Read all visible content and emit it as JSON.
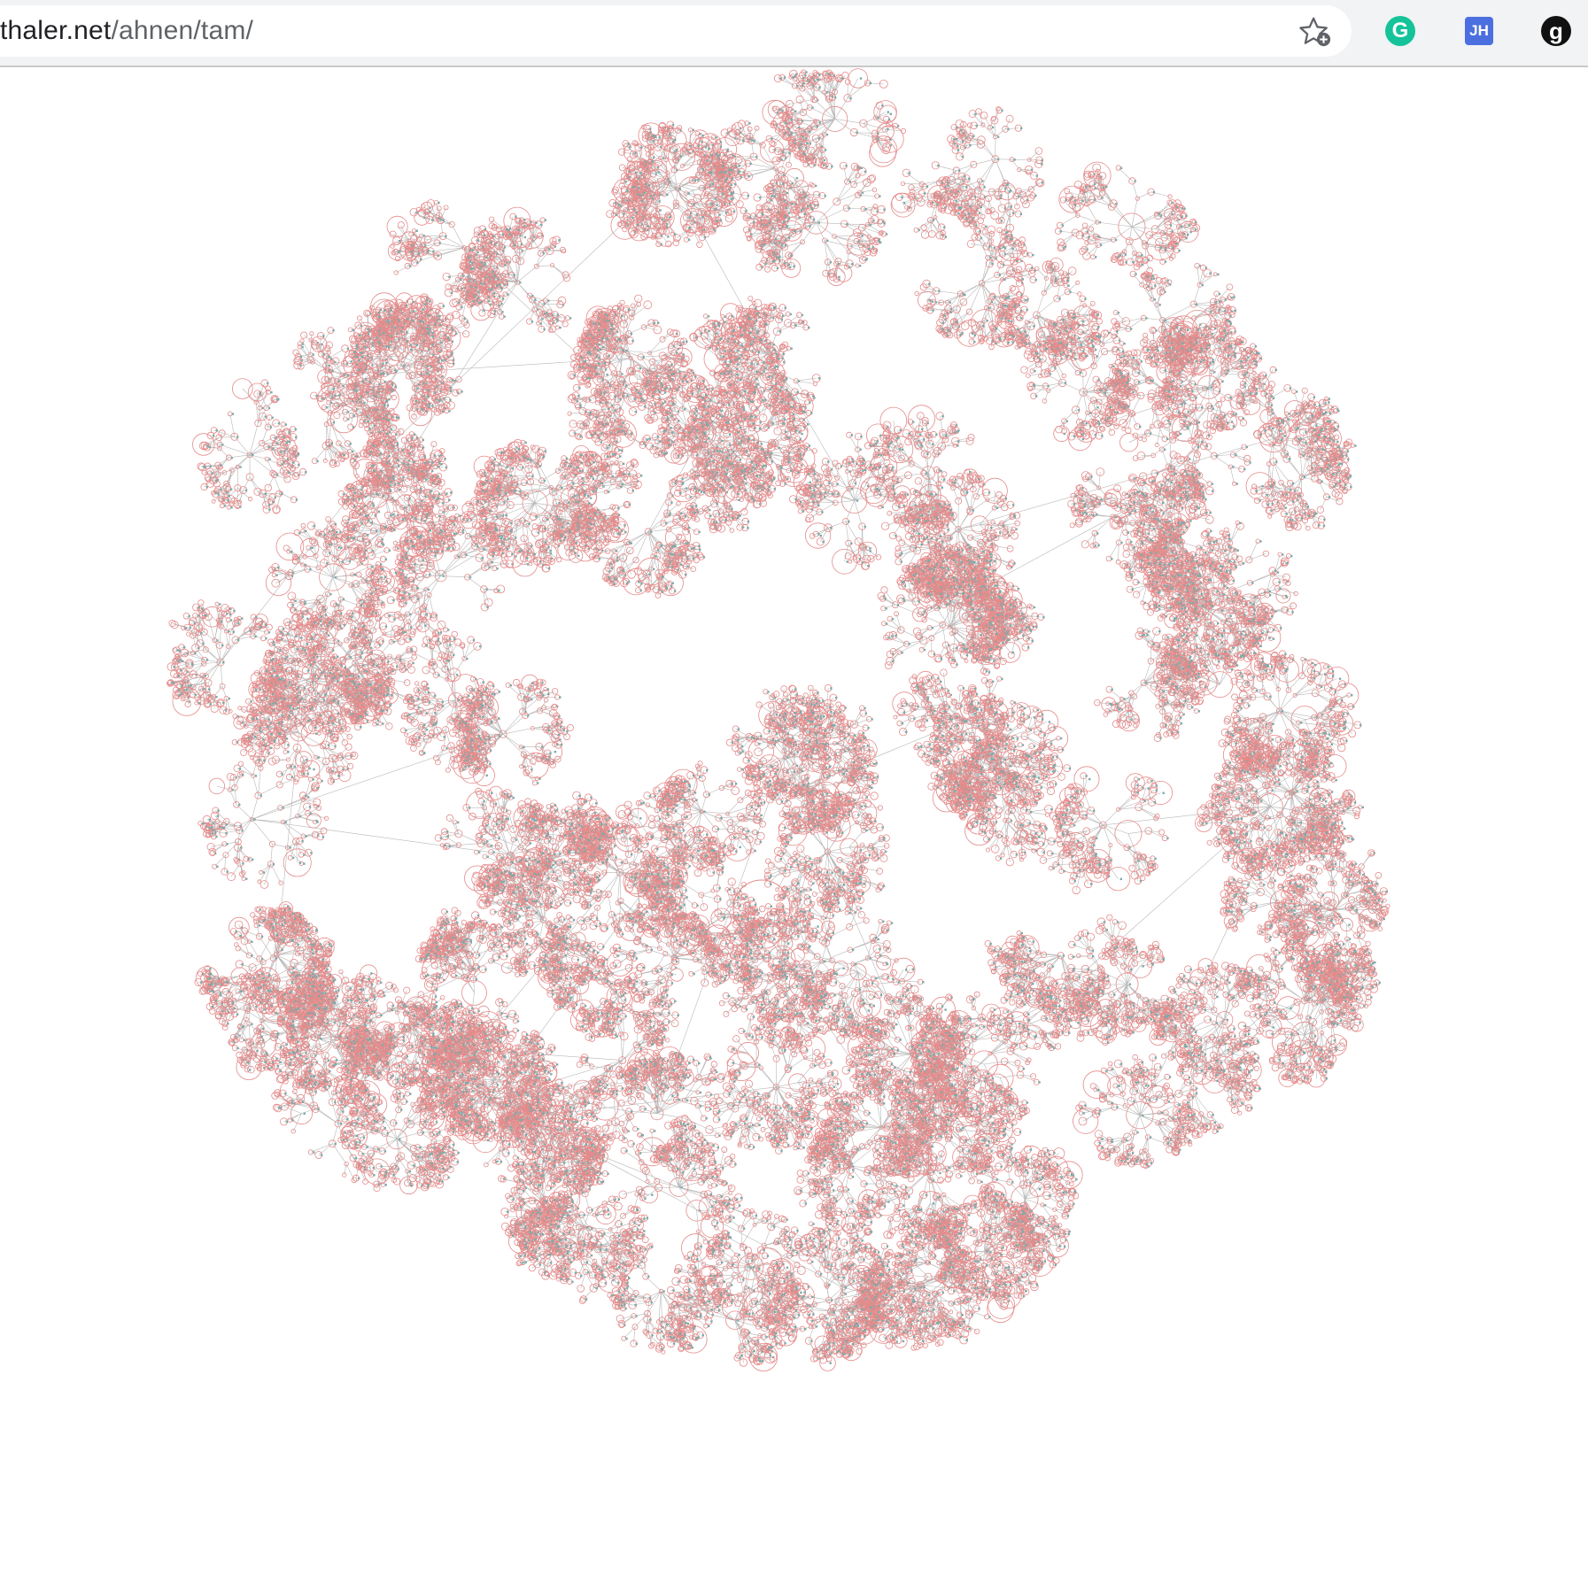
{
  "browser": {
    "url_host": "thaler.net",
    "url_path": "/ahnen/tam/",
    "bookmark_icon": "star-add-icon",
    "extensions": [
      {
        "name": "grammarly-icon",
        "glyph": "G",
        "color": "#15c39a"
      },
      {
        "name": "jh-extension-icon",
        "glyph": "JH",
        "color": "#4c6fe0"
      },
      {
        "name": "g-extension-icon",
        "glyph": "g",
        "color": "#111111"
      }
    ]
  },
  "graph": {
    "description_colors": {
      "edge": "#b8b8b8",
      "node_ring": "#e58b8b",
      "node_fill": "#7fa9a9",
      "accent": "#d9534f"
    }
  }
}
